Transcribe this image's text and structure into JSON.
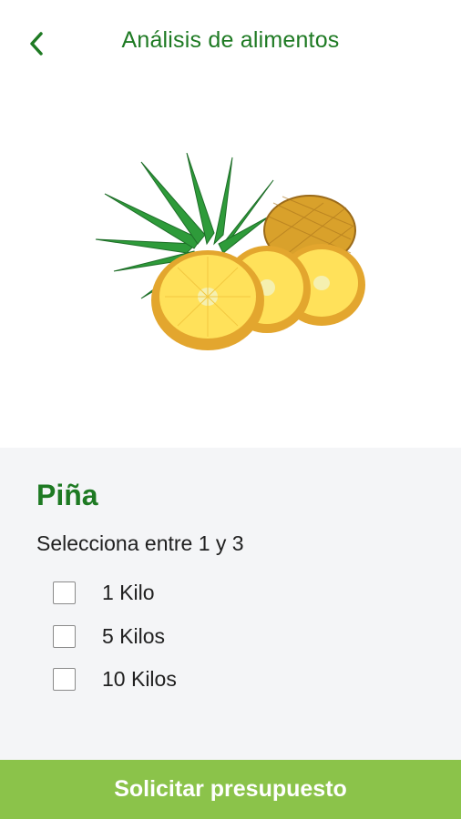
{
  "header": {
    "title": "Análisis de alimentos",
    "back_icon": "chevron-left-icon"
  },
  "product": {
    "name": "Piña",
    "instruction": "Selecciona entre 1 y 3",
    "options": [
      {
        "label": "1 Kilo",
        "checked": false
      },
      {
        "label": "5 Kilos",
        "checked": false
      },
      {
        "label": "10 Kilos",
        "checked": false
      }
    ]
  },
  "cta": {
    "label": "Solicitar presupuesto"
  },
  "colors": {
    "accent": "#1e7a23",
    "cta": "#8bc34a",
    "panel": "#f4f5f7"
  }
}
